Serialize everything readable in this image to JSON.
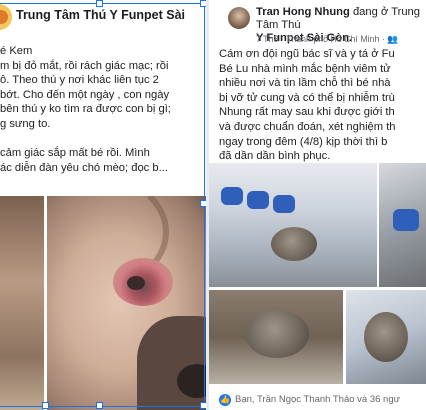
{
  "left_post": {
    "author": "Trung Tâm Thú Y Funpet Sài",
    "body_lines": [
      "é Kem",
      "m bị đỏ mắt, rồi rách giác mạc; rồi",
      "ô. Theo thú y nơi khác liên tục 2",
      "bớt. Cho đến một ngày , con ngày",
      "bên thú y ko tìm ra được con bị gì;",
      "g sưng to.",
      "",
      "cảm giác sắp mất bé rồi. Mình",
      "ác diễn đàn yêu chó mèo; đọc b..."
    ],
    "photos": [
      "photo-child-background",
      "photo-dog-eye-close-up"
    ]
  },
  "right_post": {
    "author": "Tran Hong Nhung",
    "author_suffix": " đang ở Trung Tâm Thú",
    "location_name": "Y Funpet Sài Gòn.",
    "meta": "7 Th8 · Thành phố Hồ Chí Minh · 👥",
    "body_lines": [
      "Cám ơn đội ngũ bác sĩ và y tá ở Fu",
      "Bé Lu nhà mình mắc bệnh viêm tử",
      "nhiều nơi và tin lầm chỗ thì bé nhà",
      "bị vỡ tử cung và có thể bị nhiễm trù",
      "Nhung rất may sau khi được giới th",
      "và được chuẩn đoán, xét nghiệm th",
      "ngay trong đêm (4/8) kịp thời thì b",
      "đã dần dần bình phục."
    ],
    "reactions": "Bạn, Trần Ngọc Thanh Thảo và 36 ngư"
  },
  "colors": {
    "selection_blue": "#1a73e8",
    "text_primary": "#1c1e21",
    "text_secondary": "#65676b",
    "facebook_blue": "#1877f2"
  }
}
